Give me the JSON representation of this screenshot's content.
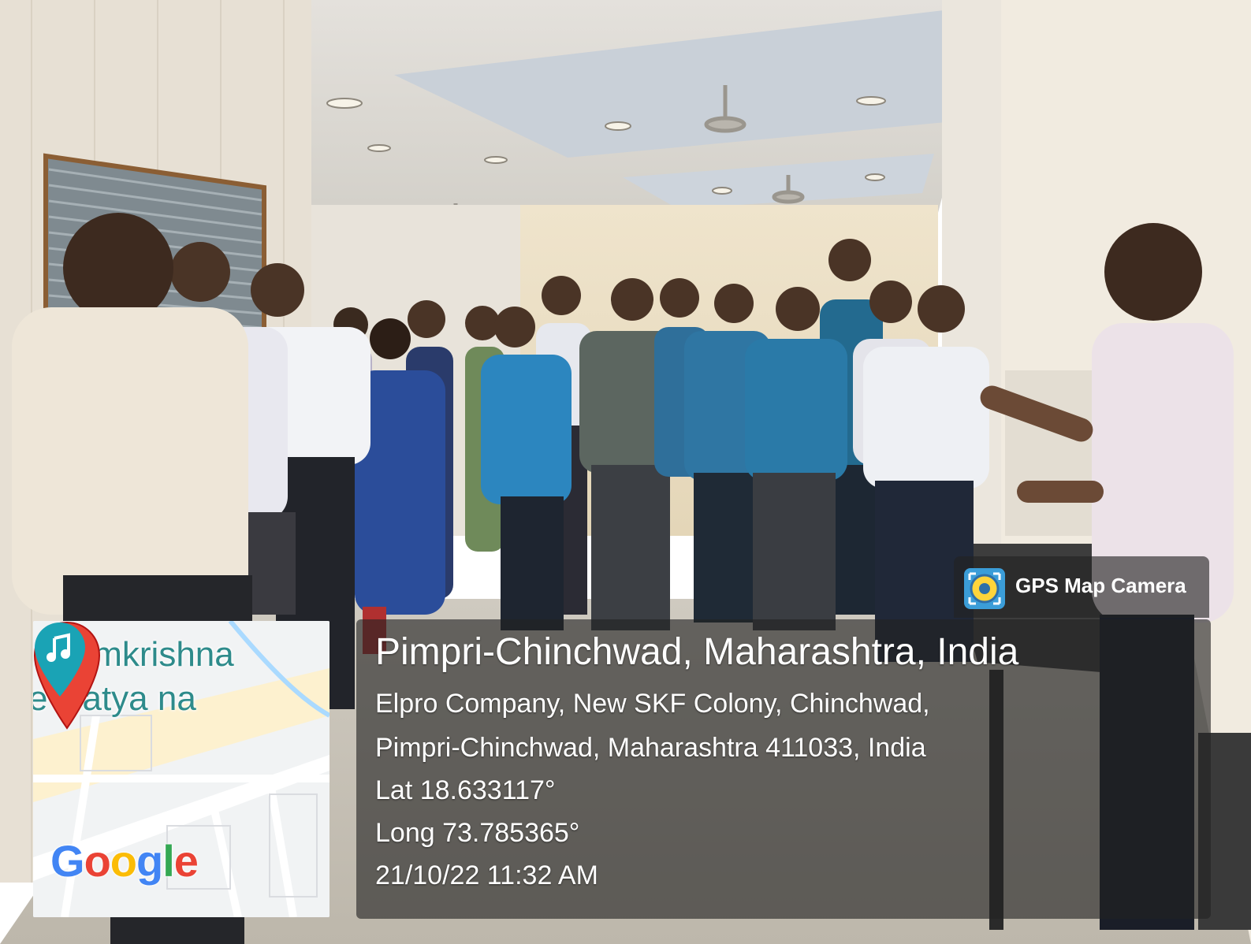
{
  "map": {
    "place_line1": "Ramkrishna",
    "place_line2": "e Natya  na",
    "logo_text": "Google",
    "logo_letters": [
      {
        "ch": "G",
        "color": "#4285F4"
      },
      {
        "ch": "o",
        "color": "#EA4335"
      },
      {
        "ch": "o",
        "color": "#FBBC05"
      },
      {
        "ch": "g",
        "color": "#4285F4"
      },
      {
        "ch": "l",
        "color": "#34A853"
      },
      {
        "ch": "e",
        "color": "#EA4335"
      }
    ],
    "pin_color": "#EA4335",
    "music_pin_color": "#1aa3b5"
  },
  "badge": {
    "label": "GPS Map Camera",
    "icon": "gps-map-camera-app-icon"
  },
  "info": {
    "title": "Pimpri-Chinchwad, Maharashtra, India",
    "address_line1": "Elpro Company, New SKF Colony, Chinchwad,",
    "address_line2": "Pimpri-Chinchwad, Maharashtra 411033, India",
    "latitude": "Lat 18.633117°",
    "longitude": "Long 73.785365°",
    "timestamp": "21/10/22 11:32 AM"
  }
}
